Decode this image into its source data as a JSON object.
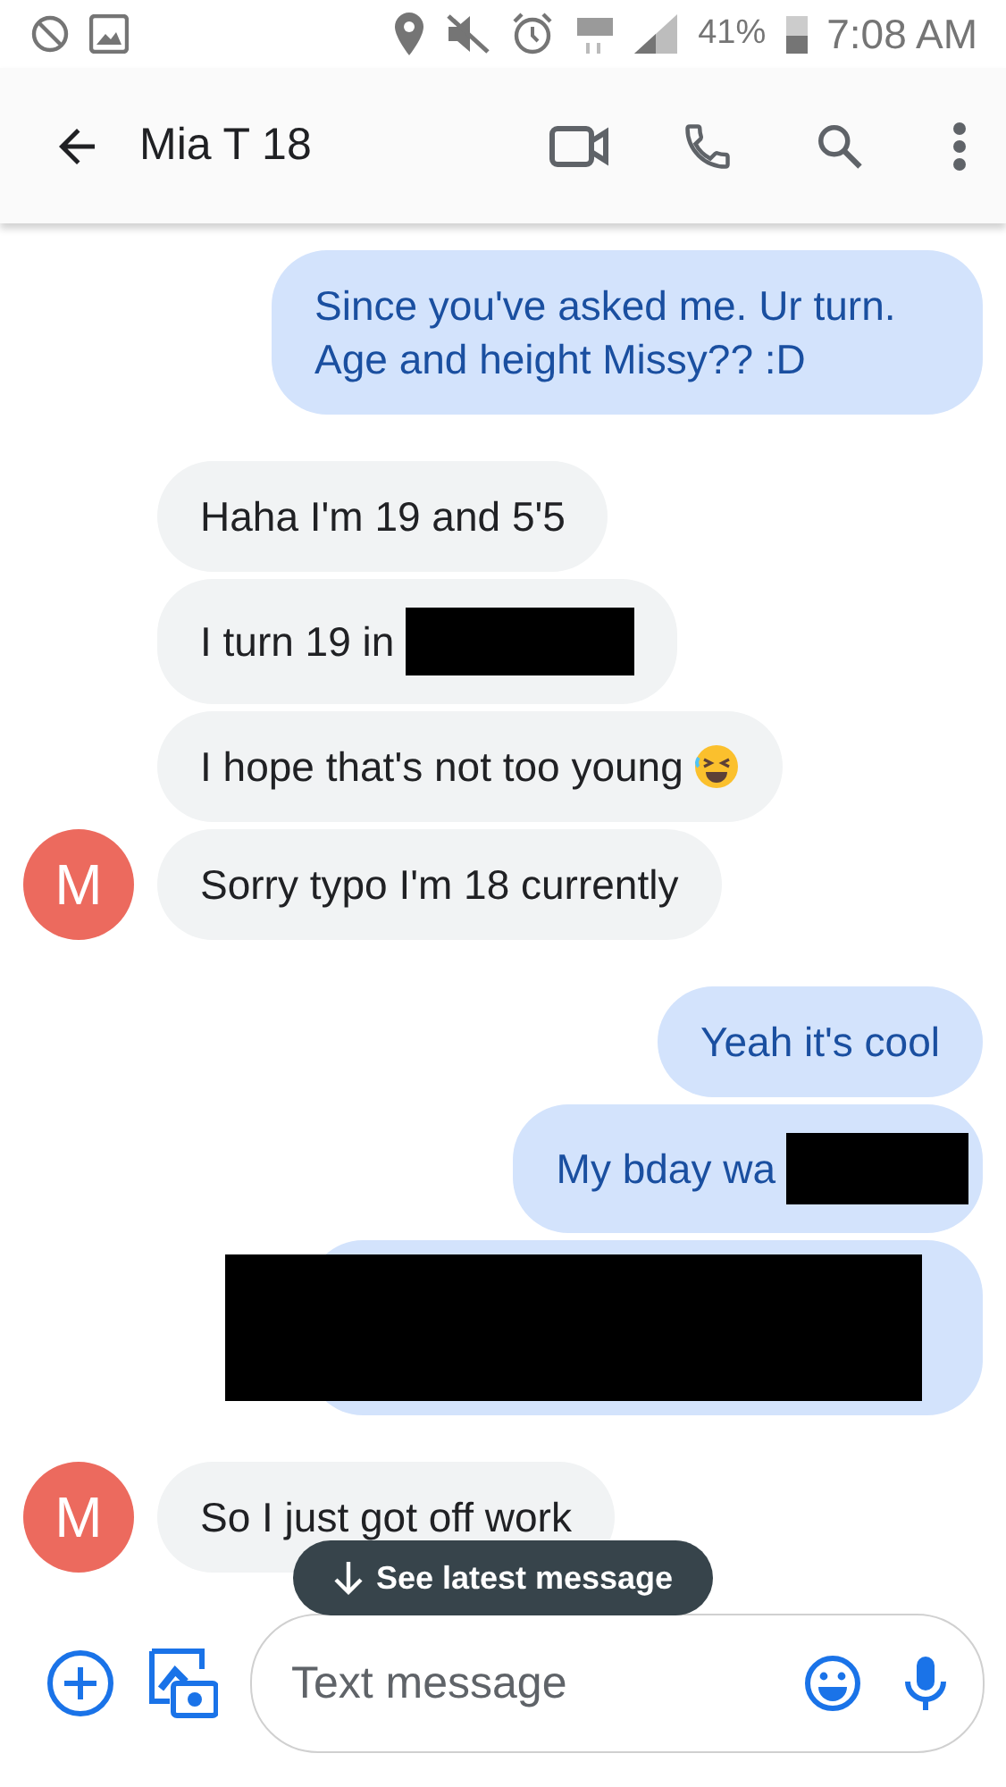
{
  "status_bar": {
    "battery": "41%",
    "time": "7:08 AM"
  },
  "header": {
    "contact": "Mia T 18"
  },
  "messages": [
    {
      "kind": "outgoing",
      "text": "Since you've asked me. Ur turn. Age and height Missy?? :D",
      "redacted": false
    },
    {
      "kind": "incoming",
      "text": "Haha I'm 19 and 5'5",
      "redacted": false
    },
    {
      "kind": "incoming",
      "text": "I turn 19 in",
      "redacted": true
    },
    {
      "kind": "incoming",
      "text": "I hope that's not too young",
      "redacted": false,
      "emoji": true
    },
    {
      "kind": "incoming",
      "text": "Sorry typo I'm 18 currently",
      "redacted": false,
      "avatar": "M"
    },
    {
      "kind": "outgoing",
      "text": "Yeah it's cool",
      "redacted": false
    },
    {
      "kind": "outgoing",
      "text": "My bday wa",
      "redacted": true
    },
    {
      "kind": "outgoing",
      "redacted": true
    },
    {
      "kind": "incoming",
      "text": "So I just got off work",
      "redacted": false,
      "avatar": "M"
    }
  ],
  "toast": {
    "label": "See latest message"
  },
  "composer": {
    "placeholder": "Text message"
  }
}
